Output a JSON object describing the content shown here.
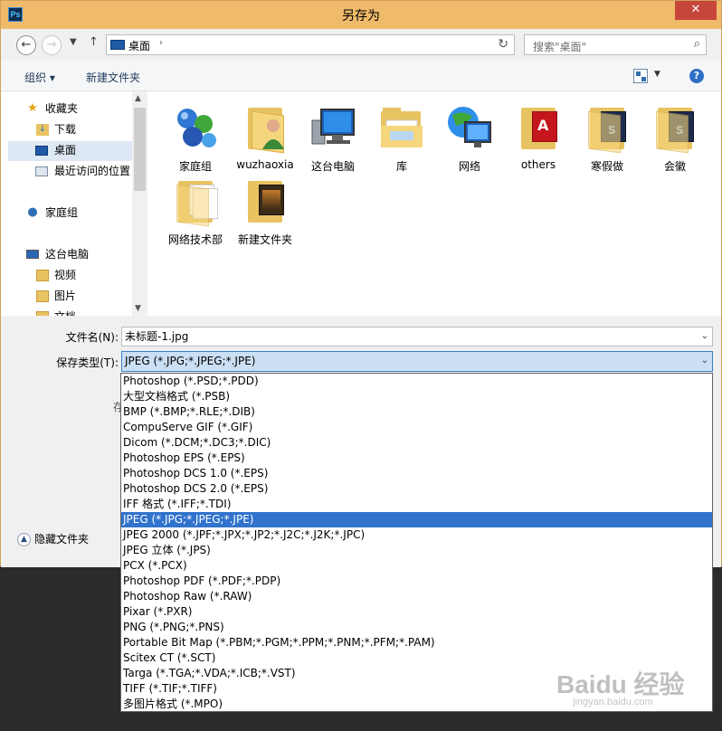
{
  "window": {
    "app_icon_text": "Ps",
    "title": "另存为",
    "close_glyph": "✕"
  },
  "address": {
    "location": "桌面",
    "chevron": "›",
    "search_placeholder": "搜索\"桌面\""
  },
  "toolbar": {
    "organize_label": "组织 ▾",
    "new_folder_label": "新建文件夹",
    "help_glyph": "?"
  },
  "nav_pane": {
    "items": [
      {
        "label": "收藏夹",
        "icon": "star-icon"
      },
      {
        "label": "下载",
        "icon": "download-folder-icon"
      },
      {
        "label": "桌面",
        "icon": "desktop-icon",
        "selected": true
      },
      {
        "label": "最近访问的位置",
        "icon": "recent-places-icon"
      },
      {
        "label": "家庭组",
        "icon": "homegroup-icon"
      },
      {
        "label": "这台电脑",
        "icon": "computer-icon"
      },
      {
        "label": "视频",
        "icon": "videos-folder-icon"
      },
      {
        "label": "图片",
        "icon": "pictures-folder-icon"
      },
      {
        "label": "文档",
        "icon": "documents-folder-icon"
      }
    ]
  },
  "files": [
    {
      "label": "家庭组",
      "icon": "homegroup-icon"
    },
    {
      "label": "wuzhaoxia",
      "icon": "user-folder-icon"
    },
    {
      "label": "这台电脑",
      "icon": "computer-icon"
    },
    {
      "label": "库",
      "icon": "library-icon"
    },
    {
      "label": "网络",
      "icon": "network-icon"
    },
    {
      "label": "others",
      "icon": "folder-icon"
    },
    {
      "label": "寒假做",
      "icon": "folder-icon"
    },
    {
      "label": "会徽",
      "icon": "folder-icon"
    },
    {
      "label": "网络技术部",
      "icon": "folder-icon"
    },
    {
      "label": "新建文件夹",
      "icon": "folder-icon"
    }
  ],
  "form": {
    "filename_label": "文件名(N):",
    "filename_value": "未标题-1.jpg",
    "filetype_label": "保存类型(T):",
    "filetype_value": "JPEG (*.JPG;*.JPEG;*.JPE)",
    "hidden_label_fragment": "存",
    "hide_folders_label": "隐藏文件夹"
  },
  "filetype_options": [
    "Photoshop (*.PSD;*.PDD)",
    "大型文档格式 (*.PSB)",
    "BMP (*.BMP;*.RLE;*.DIB)",
    "CompuServe GIF (*.GIF)",
    "Dicom (*.DCM;*.DC3;*.DIC)",
    "Photoshop EPS (*.EPS)",
    "Photoshop DCS 1.0 (*.EPS)",
    "Photoshop DCS 2.0 (*.EPS)",
    "IFF 格式 (*.IFF;*.TDI)",
    "JPEG (*.JPG;*.JPEG;*.JPE)",
    "JPEG 2000 (*.JPF;*.JPX;*.JP2;*.J2C;*.J2K;*.JPC)",
    "JPEG 立体 (*.JPS)",
    "PCX (*.PCX)",
    "Photoshop PDF (*.PDF;*.PDP)",
    "Photoshop Raw (*.RAW)",
    "Pixar (*.PXR)",
    "PNG (*.PNG;*.PNS)",
    "Portable Bit Map (*.PBM;*.PGM;*.PPM;*.PNM;*.PFM;*.PAM)",
    "Scitex CT (*.SCT)",
    "Targa (*.TGA;*.VDA;*.ICB;*.VST)",
    "TIFF (*.TIF;*.TIFF)",
    "多图片格式 (*.MPO)"
  ],
  "selected_option_index": 9,
  "watermark": {
    "main": "Baidu 经验",
    "sub": "jingyan.baidu.com"
  }
}
